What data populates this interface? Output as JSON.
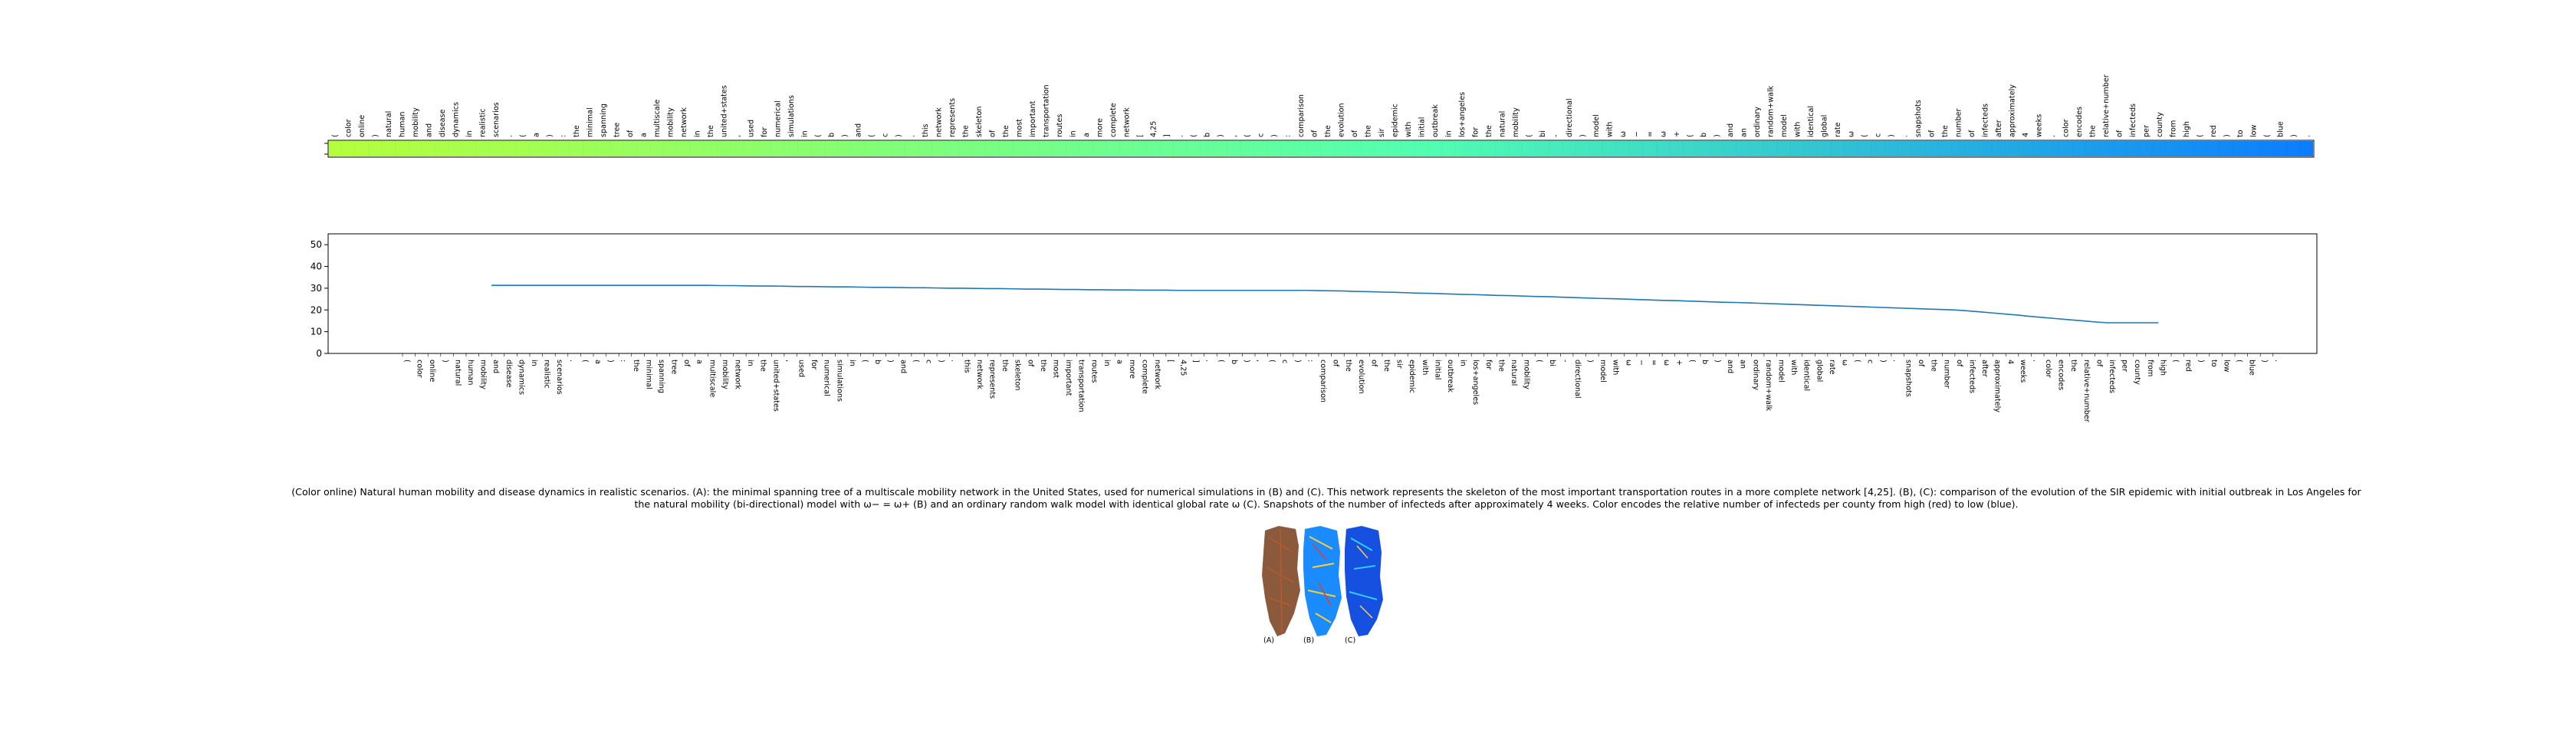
{
  "caption": "(Color online) Natural human mobility and disease dynamics in realistic scenarios. (A): the minimal spanning tree of a multiscale mobility network in the United States, used for numerical simulations in (B) and (C). This network represents the skeleton of the most important transportation routes in a more complete network [4,25]. (B), (C): comparison of the evolution of the SIR epidemic with initial outbreak in Los Angeles for the natural mobility (bi-directional) model with ω− = ω+ (B) and an ordinary random walk model with identical global rate ω (C). Snapshots of the number of infecteds after approximately 4 weeks. Color encodes the relative number of infecteds per county from high (red) to low (blue).",
  "colors": {
    "line": "#1f77b4",
    "heat_start": "#b4ff3c",
    "heat_mid": "#52ffb0",
    "heat_end": "#0a7dff",
    "map_a": "#8b5a3c",
    "map_b": "#1a8cff",
    "map_c": "#1550e0"
  },
  "chart_data": [
    {
      "type": "heatmap",
      "tokens": [
        "(",
        "color",
        "online",
        ")",
        "natural",
        "human",
        "mobility",
        "and",
        "disease",
        "dynamics",
        "in",
        "realistic",
        "scenarios",
        ".",
        "(",
        "a",
        ")",
        ":",
        "the",
        "minimal",
        "spanning",
        "tree",
        "of",
        "a",
        "multiscale",
        "mobility",
        "network",
        "in",
        "the",
        "united+states",
        ",",
        "used",
        "for",
        "numerical",
        "simulations",
        "in",
        "(",
        "b",
        ")",
        "and",
        "(",
        "c",
        ")",
        ".",
        "this",
        "network",
        "represents",
        "the",
        "skeleton",
        "of",
        "the",
        "most",
        "important",
        "transportation",
        "routes",
        "in",
        "a",
        "more",
        "complete",
        "network",
        "[",
        "4,25",
        "]",
        ".",
        "(",
        "b",
        ")",
        ",",
        "(",
        "c",
        ")",
        ":",
        "comparison",
        "of",
        "the",
        "evolution",
        "of",
        "the",
        "sir",
        "epidemic",
        "with",
        "initial",
        "outbreak",
        "in",
        "los+angeles",
        "for",
        "the",
        "natural",
        "mobility",
        "(",
        "bi",
        "-",
        "directional",
        ")",
        "model",
        "with",
        "ω",
        "−",
        "=",
        "ω",
        "+",
        "(",
        "b",
        ")",
        "and",
        "an",
        "ordinary",
        "random+walk",
        "model",
        "with",
        "identical",
        "global",
        "rate",
        "ω",
        "(",
        "c",
        ")",
        ".",
        "snapshots",
        "of",
        "the",
        "number",
        "of",
        "infecteds",
        "after",
        "approximately",
        "4",
        "weeks",
        ".",
        "color",
        "encodes",
        "the",
        "relative+number",
        "of",
        "infecteds",
        "per",
        "county",
        "from",
        "high",
        "(",
        "red",
        ")",
        "to",
        "low",
        "(",
        "blue",
        ")",
        "."
      ],
      "colormap": [
        "#b4ff3c",
        "#52ffb0",
        "#0a7dff"
      ],
      "tick_count": 2
    },
    {
      "type": "line",
      "x_labels_source": "tokens",
      "series": [
        {
          "values": [
            null,
            null,
            null,
            null,
            null,
            null,
            null,
            31.3,
            31.3,
            31.3,
            31.3,
            31.3,
            31.3,
            31.3,
            31.3,
            31.3,
            31.3,
            31.3,
            31.3,
            31.3,
            31.3,
            31.3,
            31.3,
            31.3,
            31.3,
            31.2,
            31.2,
            31.1,
            31.0,
            31.0,
            30.9,
            30.8,
            30.8,
            30.7,
            30.6,
            30.6,
            30.5,
            30.4,
            30.4,
            30.3,
            30.2,
            30.2,
            30.1,
            30.0,
            30.0,
            29.9,
            29.8,
            29.8,
            29.7,
            29.6,
            29.6,
            29.5,
            29.4,
            29.4,
            29.3,
            29.3,
            29.2,
            29.2,
            29.1,
            29.1,
            29.1,
            29.0,
            29.0,
            29.0,
            29.0,
            29.0,
            29.0,
            29.0,
            29.0,
            29.0,
            29.0,
            29.0,
            28.9,
            28.8,
            28.7,
            28.5,
            28.4,
            28.2,
            28.1,
            27.9,
            27.7,
            27.6,
            27.4,
            27.2,
            27.1,
            26.9,
            26.7,
            26.6,
            26.4,
            26.2,
            26.1,
            25.9,
            25.7,
            25.5,
            25.3,
            25.2,
            25.0,
            24.8,
            24.6,
            24.4,
            24.3,
            24.1,
            23.9,
            23.7,
            23.5,
            23.4,
            23.2,
            23.0,
            22.8,
            22.6,
            22.4,
            22.2,
            22.0,
            21.8,
            21.6,
            21.4,
            21.2,
            21.0,
            20.8,
            20.6,
            20.4,
            20.2,
            20.0,
            19.6,
            19.1,
            18.6,
            18.1,
            17.6,
            17.0,
            16.5,
            16.0,
            15.5,
            15.0,
            14.5,
            14.1,
            14.1,
            14.1,
            14.1,
            14.1,
            null,
            null,
            null,
            null,
            null,
            null
          ]
        }
      ],
      "yticks": [
        "0",
        "10",
        "20",
        "30",
        "40",
        "50"
      ],
      "ylim": [
        0,
        55
      ]
    }
  ],
  "thumbnails": [
    {
      "label": "(A)"
    },
    {
      "label": "(B)"
    },
    {
      "label": "(C)"
    }
  ]
}
